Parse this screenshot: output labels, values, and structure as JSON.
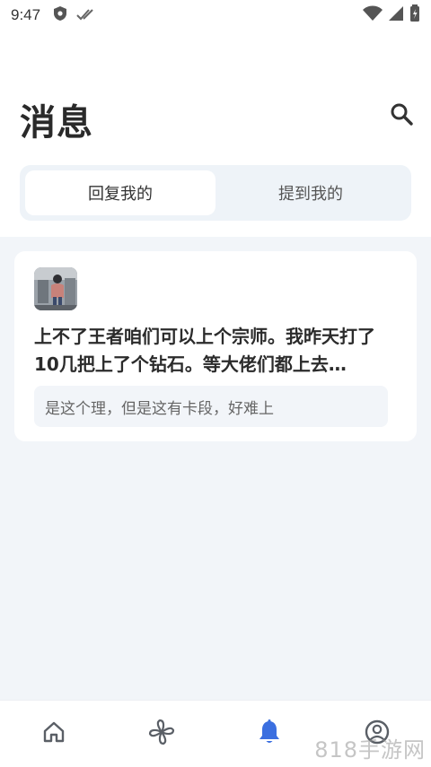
{
  "status_bar": {
    "time": "9:47",
    "icons": [
      "shield-icon",
      "double-check-icon",
      "wifi-icon",
      "signal-icon",
      "battery-icon"
    ]
  },
  "header": {
    "title": "消息",
    "search_icon": "search-icon"
  },
  "tabs": [
    {
      "label": "回复我的",
      "active": true
    },
    {
      "label": "提到我的",
      "active": false
    }
  ],
  "messages": [
    {
      "avatar": "user-avatar",
      "text": "上不了王者咱们可以上个宗师。我昨天打了10几把上了个钻石。等大佬们都上去…",
      "quote": "是这个理，但是这有卡段，好难上"
    }
  ],
  "bottom_nav": [
    {
      "icon": "home-icon",
      "active": false
    },
    {
      "icon": "pinwheel-icon",
      "active": false
    },
    {
      "icon": "bell-icon",
      "active": true
    },
    {
      "icon": "user-circle-icon",
      "active": false
    }
  ],
  "watermark": "818手游网",
  "colors": {
    "accent": "#3b6fe0",
    "background": "#f2f5f9",
    "icon_gray": "#5a5f66"
  }
}
